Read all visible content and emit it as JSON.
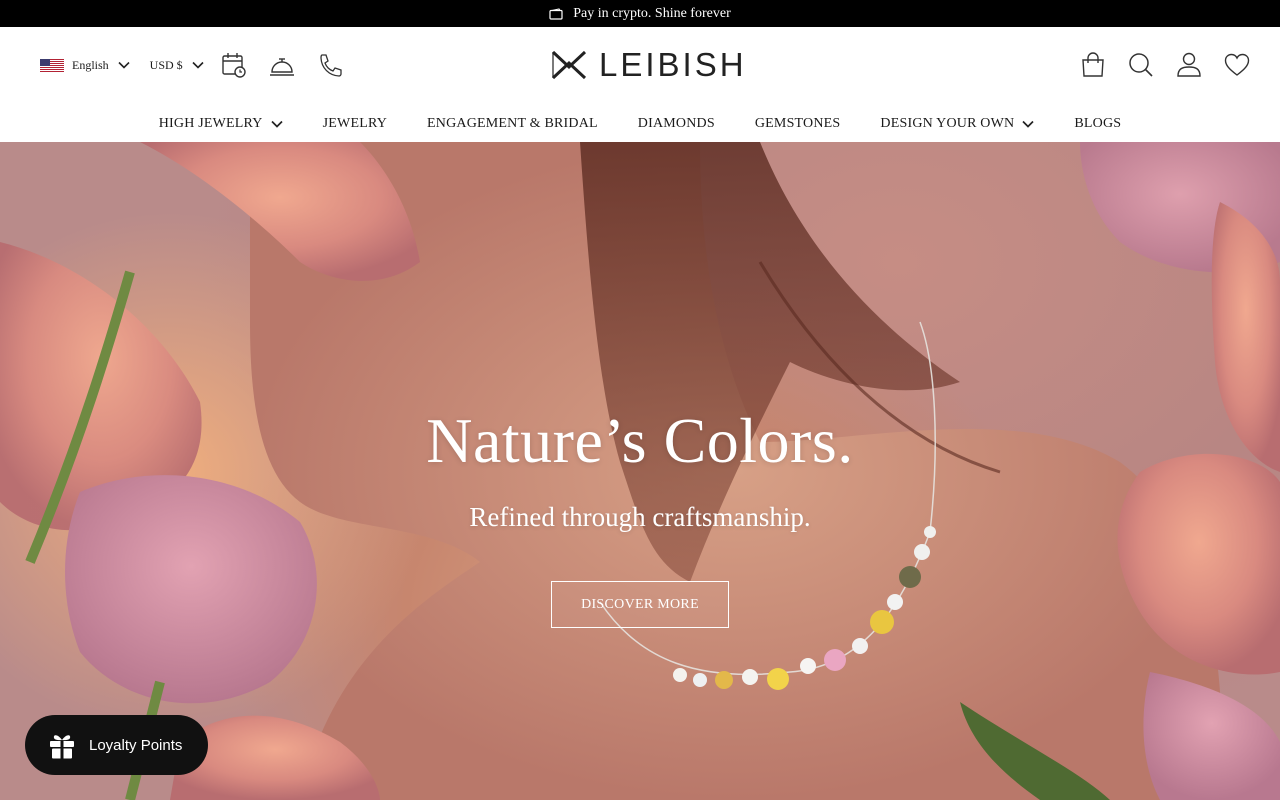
{
  "announcement": {
    "text": "Pay in crypto. Shine forever",
    "icon": "wallet-icon"
  },
  "header": {
    "language": "English",
    "currency": "USD $",
    "brand": "LEIBISH",
    "utility_icons": [
      "calendar-clock-icon",
      "service-bell-icon",
      "phone-icon"
    ],
    "right_icons": [
      "shopping-bag-icon",
      "search-icon",
      "account-icon",
      "wishlist-heart-icon"
    ]
  },
  "nav": {
    "items": [
      {
        "label": "HIGH JEWELRY",
        "dropdown": true
      },
      {
        "label": "JEWELRY",
        "dropdown": false
      },
      {
        "label": "ENGAGEMENT & BRIDAL",
        "dropdown": false
      },
      {
        "label": "DIAMONDS",
        "dropdown": false
      },
      {
        "label": "GEMSTONES",
        "dropdown": false
      },
      {
        "label": "DESIGN YOUR OWN",
        "dropdown": true
      },
      {
        "label": "BLOGS",
        "dropdown": false
      }
    ]
  },
  "hero": {
    "title": "Nature’s Colors.",
    "subtitle": "Refined through craftsmanship.",
    "cta": "DISCOVER MORE"
  },
  "loyalty": {
    "label": "Loyalty Points",
    "icon": "gift-icon"
  },
  "colors": {
    "announcement_bg": "#000000",
    "loyalty_bg": "#111111",
    "hero_text": "#ffffff"
  }
}
